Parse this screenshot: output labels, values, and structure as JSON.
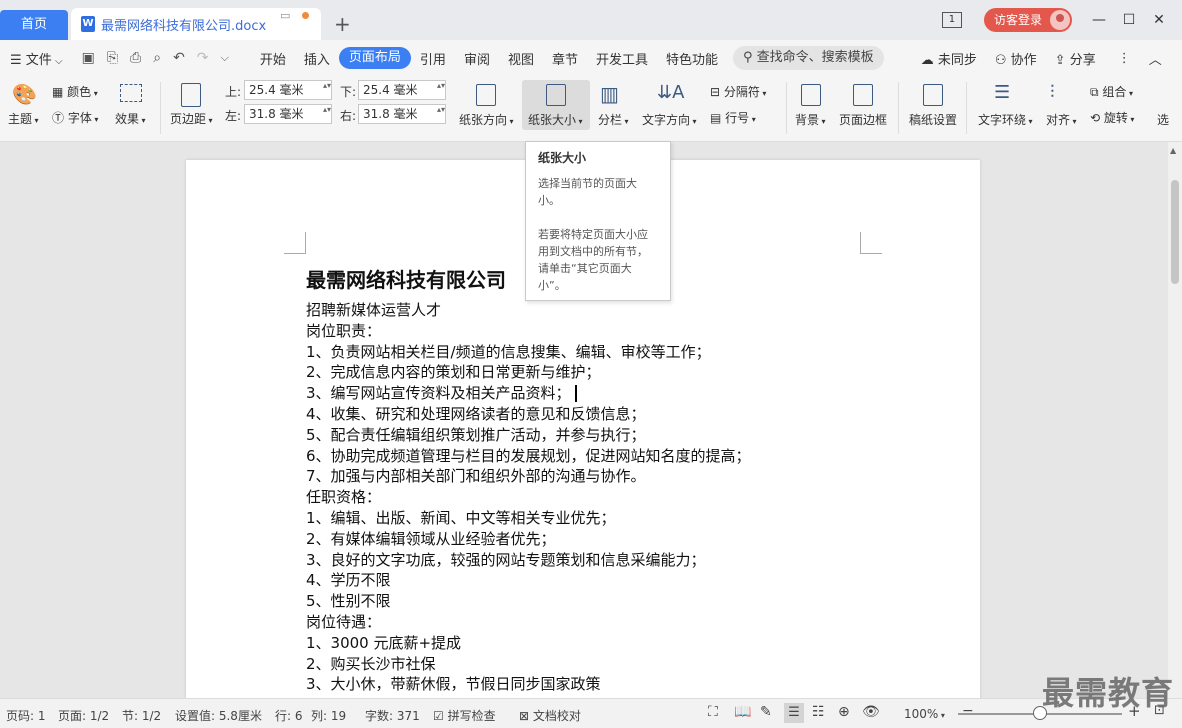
{
  "tabs": {
    "home": "首页",
    "doc_title": "最需网络科技有限公司.docx",
    "doc_icon": "W"
  },
  "window": {
    "page_indicator": "1",
    "login": "访客登录",
    "minimize": "—",
    "maximize": "☐",
    "close": "✕"
  },
  "menu": {
    "file": "文件",
    "items": [
      "开始",
      "插入",
      "页面布局",
      "引用",
      "审阅",
      "视图",
      "章节",
      "开发工具",
      "特色功能"
    ],
    "active": "页面布局",
    "search": "查找命令、搜索模板",
    "sync": "未同步",
    "collab": "协作",
    "share": "分享"
  },
  "ribbon": {
    "theme": "主题",
    "color": "颜色",
    "font": "字体",
    "effect": "效果",
    "margin": "页边距",
    "top_label": "上:",
    "top_value": "25.4 毫米",
    "bottom_label": "下:",
    "bottom_value": "25.4 毫米",
    "left_label": "左:",
    "left_value": "31.8 毫米",
    "right_label": "右:",
    "right_value": "31.8 毫米",
    "orientation": "纸张方向",
    "size": "纸张大小",
    "columns": "分栏",
    "text_direction": "文字方向",
    "separator": "分隔符",
    "line_number": "行号",
    "background": "背景",
    "page_border": "页面边框",
    "manuscript": "稿纸设置",
    "text_wrap": "文字环绕",
    "align": "对齐",
    "group": "组合",
    "rotate": "旋转",
    "select": "选"
  },
  "tooltip": {
    "title": "纸张大小",
    "desc1": "选择当前节的页面大小。",
    "desc2": "若要将特定页面大小应用到文档中的所有节，请单击“其它页面大小”。"
  },
  "document": {
    "title": "最需网络科技有限公司",
    "lines": [
      "招聘新媒体运营人才",
      "岗位职责：",
      "1、负责网站相关栏目/频道的信息搜集、编辑、审校等工作；",
      "2、完成信息内容的策划和日常更新与维护；",
      "3、编写网站宣传资料及相关产品资料；",
      "4、收集、研究和处理网络读者的意见和反馈信息；",
      "5、配合责任编辑组织策划推广活动，并参与执行；",
      "6、协助完成频道管理与栏目的发展规划，促进网站知名度的提高；",
      "7、加强与内部相关部门和组织外部的沟通与协作。",
      "任职资格：",
      "1、编辑、出版、新闻、中文等相关专业优先；",
      "2、有媒体编辑领域从业经验者优先；",
      "3、良好的文字功底，较强的网站专题策划和信息采编能力；",
      "4、学历不限",
      "5、性别不限",
      "岗位待遇：",
      "1、3000 元底薪+提成",
      "2、购买长沙市社保",
      "3、大小休，带薪休假，节假日同步国家政策"
    ]
  },
  "status": {
    "page_no": "页码: 1",
    "pages": "页面: 1/2",
    "section": "节: 1/2",
    "setting": "设置值: 5.8厘米",
    "row": "行: 6",
    "col": "列: 19",
    "words": "字数: 371",
    "spellcheck": "拼写检查",
    "proofread": "文档校对",
    "zoom": "100%",
    "zoom_fraction": 0.5
  },
  "watermark": "最需教育"
}
